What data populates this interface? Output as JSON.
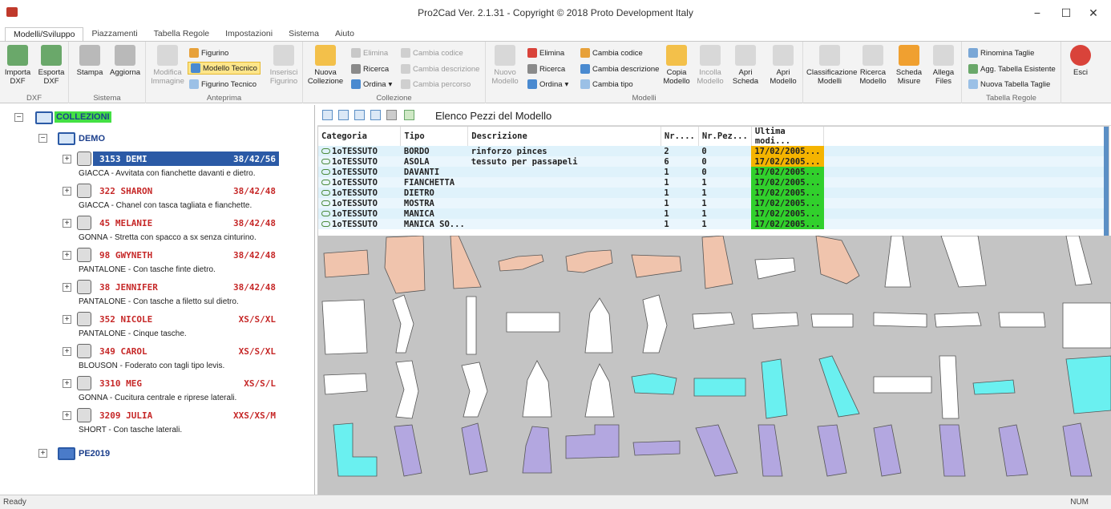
{
  "window": {
    "title": "Pro2Cad Ver. 2.1.31 - Copyright © 2018 Proto Development Italy",
    "minimize": "−",
    "maximize": "☐",
    "close": "✕"
  },
  "menu_tabs": [
    "Modelli/Sviluppo",
    "Piazzamenti",
    "Tabella Regole",
    "Impostazioni",
    "Sistema",
    "Aiuto"
  ],
  "ribbon": {
    "dxf": {
      "label": "DXF",
      "import": "Importa DXF",
      "export": "Esporta DXF"
    },
    "sistema": {
      "label": "Sistema",
      "print": "Stampa",
      "update": "Aggiorna"
    },
    "anteprima": {
      "label": "Anteprima",
      "edit_image": "Modifica Immagine",
      "figurino": "Figurino",
      "modello_tecnico": "Modello Tecnico",
      "figurino_tecnico": "Figurino Tecnico",
      "insert_figurino": "Inserisci Figurino"
    },
    "collezione": {
      "label": "Collezione",
      "new": "Nuova Collezione",
      "delete": "Elimina",
      "search": "Ricerca",
      "sort": "Ordina",
      "change_code": "Cambia codice",
      "change_desc": "Cambia descrizione",
      "change_path": "Cambia percorso"
    },
    "modelli": {
      "label": "Modelli",
      "new_model": "Nuovo Modello",
      "delete": "Elimina",
      "search": "Ricerca",
      "sort": "Ordina",
      "change_code": "Cambia codice",
      "change_desc": "Cambia descrizione",
      "change_type": "Cambia tipo",
      "copy": "Copia Modello",
      "paste": "Incolla Modello",
      "open_sheet": "Apri Scheda",
      "open_model": "Apri Modello"
    },
    "extra": {
      "classify": "Classificazione Modelli",
      "search_model": "Ricerca Modello",
      "measure_sheet": "Scheda Misure",
      "attach": "Allega Files"
    },
    "tabella_regole": {
      "label": "Tabella Regole",
      "rename": "Rinomina Taglie",
      "update_existing": "Agg. Tabella Esistente",
      "new_table": "Nuova Tabella Taglie"
    },
    "exit": "Esci"
  },
  "tree": {
    "root": "COLLEZIONI",
    "collection": "DEMO",
    "models": [
      {
        "name": "3153 DEMI",
        "sizes": "38/42/56",
        "desc": "GIACCA - Avvitata con fianchette davanti e dietro."
      },
      {
        "name": "322 SHARON",
        "sizes": "38/42/48",
        "desc": "GIACCA - Chanel con tasca tagliata e fianchette."
      },
      {
        "name": "45 MELANIE",
        "sizes": "38/42/48",
        "desc": "GONNA - Stretta con spacco a sx senza cinturino."
      },
      {
        "name": "98 GWYNETH",
        "sizes": "38/42/48",
        "desc": "PANTALONE - Con tasche finte dietro."
      },
      {
        "name": "38 JENNIFER",
        "sizes": "38/42/48",
        "desc": "PANTALONE - Con tasche a filetto sul dietro."
      },
      {
        "name": "352 NICOLE",
        "sizes": "XS/S/XL",
        "desc": "PANTALONE - Cinque tasche."
      },
      {
        "name": "349 CAROL",
        "sizes": "XS/S/XL",
        "desc": "BLOUSON - Foderato con tagli tipo levis."
      },
      {
        "name": "3310 MEG",
        "sizes": "XS/S/L",
        "desc": "GONNA - Cucitura centrale e riprese laterali."
      },
      {
        "name": "3209 JULIA",
        "sizes": "XXS/XS/M",
        "desc": "SHORT - Con tasche laterali."
      }
    ],
    "other_collection": "PE2019"
  },
  "pieces_panel": {
    "title": "Elenco Pezzi del Modello",
    "columns": [
      "Categoria",
      "Tipo",
      "Descrizione",
      "Nr....",
      "Nr.Pez...",
      "Ultima modi..."
    ],
    "rows": [
      {
        "cat": "1oTESSUTO",
        "tipo": "BORDO",
        "desc": "rinforzo pinces",
        "nr": "2",
        "nrpez": "0",
        "date": "17/02/2005...",
        "date_status": "orange"
      },
      {
        "cat": "1oTESSUTO",
        "tipo": "ASOLA",
        "desc": "tessuto per passapeli",
        "nr": "6",
        "nrpez": "0",
        "date": "17/02/2005...",
        "date_status": "orange"
      },
      {
        "cat": "1oTESSUTO",
        "tipo": "DAVANTI",
        "desc": "",
        "nr": "1",
        "nrpez": "0",
        "date": "17/02/2005...",
        "date_status": "green"
      },
      {
        "cat": "1oTESSUTO",
        "tipo": "FIANCHETTA",
        "desc": "",
        "nr": "1",
        "nrpez": "1",
        "date": "17/02/2005...",
        "date_status": "green"
      },
      {
        "cat": "1oTESSUTO",
        "tipo": "DIETRO",
        "desc": "",
        "nr": "1",
        "nrpez": "1",
        "date": "17/02/2005...",
        "date_status": "green"
      },
      {
        "cat": "1oTESSUTO",
        "tipo": "MOSTRA",
        "desc": "",
        "nr": "1",
        "nrpez": "1",
        "date": "17/02/2005...",
        "date_status": "green"
      },
      {
        "cat": "1oTESSUTO",
        "tipo": "MANICA",
        "desc": "",
        "nr": "1",
        "nrpez": "1",
        "date": "17/02/2005...",
        "date_status": "green"
      },
      {
        "cat": "1oTESSUTO",
        "tipo": "MANICA SO...",
        "desc": "",
        "nr": "1",
        "nrpez": "1",
        "date": "17/02/2005...",
        "date_status": "green"
      }
    ],
    "colors": {
      "orange": "#f5b400",
      "green": "#31d02c"
    }
  },
  "piece_colors": {
    "salmon": "#f0c4ad",
    "white": "#ffffff",
    "cyan": "#6af0f0",
    "lavender": "#b3a7e0"
  },
  "status": {
    "left": "Ready",
    "right": "NUM"
  }
}
